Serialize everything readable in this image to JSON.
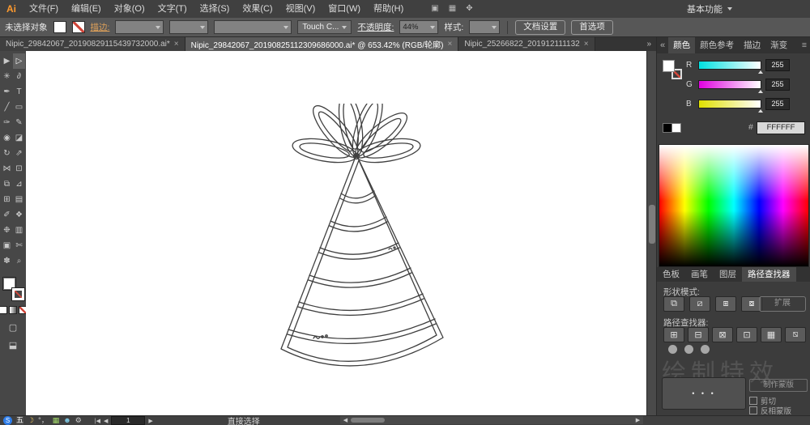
{
  "menubar": {
    "logo": "Ai",
    "items": [
      {
        "id": "file",
        "label": "文件(F)"
      },
      {
        "id": "edit",
        "label": "编辑(E)"
      },
      {
        "id": "object",
        "label": "对象(O)"
      },
      {
        "id": "type",
        "label": "文字(T)"
      },
      {
        "id": "select",
        "label": "选择(S)"
      },
      {
        "id": "effect",
        "label": "效果(C)"
      },
      {
        "id": "view",
        "label": "视图(V)"
      },
      {
        "id": "window",
        "label": "窗口(W)"
      },
      {
        "id": "help",
        "label": "帮助(H)"
      }
    ],
    "right_icons": [
      {
        "id": "arrange-documents-icon",
        "glyph": "▣"
      },
      {
        "id": "workspace-grid-icon",
        "glyph": "▦"
      },
      {
        "id": "cs-services-icon",
        "glyph": "✥"
      }
    ],
    "workspace": "基本功能"
  },
  "controlbar": {
    "selection_status": "未选择对象",
    "stroke_label": "描边:",
    "touch_button": "Touch C...",
    "opacity_label": "不透明度:",
    "opacity_value": "44%",
    "style_label": "样式:",
    "document_setup": "文档设置",
    "preferences": "首选项"
  },
  "document_tabs": {
    "tabs": [
      {
        "title": "Nipic_29842067_20190829115439732000.ai*",
        "active": false
      },
      {
        "title": "Nipic_29842067_20190825112309686000.ai* @ 653.42% (RGB/轮廓)",
        "active": true
      },
      {
        "title": "Nipic_25266822_201912111132",
        "active": false
      }
    ],
    "overflow_icon": "»"
  },
  "toolbar": {
    "tools": [
      {
        "id": "selection-tool",
        "glyph": "▶",
        "active": false
      },
      {
        "id": "direct-selection-tool",
        "glyph": "▷",
        "active": true
      },
      {
        "id": "magic-wand-tool",
        "glyph": "✳",
        "active": false
      },
      {
        "id": "lasso-tool",
        "glyph": "∂",
        "active": false
      },
      {
        "id": "pen-tool",
        "glyph": "✒",
        "active": false
      },
      {
        "id": "type-tool",
        "glyph": "T",
        "active": false
      },
      {
        "id": "line-segment-tool",
        "glyph": "╱",
        "active": false
      },
      {
        "id": "rectangle-tool",
        "glyph": "▭",
        "active": false
      },
      {
        "id": "paintbrush-tool",
        "glyph": "✑",
        "active": false
      },
      {
        "id": "pencil-tool",
        "glyph": "✎",
        "active": false
      },
      {
        "id": "blob-brush-tool",
        "glyph": "◉",
        "active": false
      },
      {
        "id": "eraser-tool",
        "glyph": "◪",
        "active": false
      },
      {
        "id": "rotate-tool",
        "glyph": "↻",
        "active": false
      },
      {
        "id": "scale-tool",
        "glyph": "⇗",
        "active": false
      },
      {
        "id": "width-tool",
        "glyph": "⋈",
        "active": false
      },
      {
        "id": "free-transform-tool",
        "glyph": "⊡",
        "active": false
      },
      {
        "id": "shape-builder-tool",
        "glyph": "⧉",
        "active": false
      },
      {
        "id": "perspective-grid-tool",
        "glyph": "⊿",
        "active": false
      },
      {
        "id": "mesh-tool",
        "glyph": "⊞",
        "active": false
      },
      {
        "id": "gradient-tool",
        "glyph": "▤",
        "active": false
      },
      {
        "id": "eyedropper-tool",
        "glyph": "✐",
        "active": false
      },
      {
        "id": "blend-tool",
        "glyph": "❖",
        "active": false
      },
      {
        "id": "symbol-sprayer-tool",
        "glyph": "❉",
        "active": false
      },
      {
        "id": "column-graph-tool",
        "glyph": "▥",
        "active": false
      },
      {
        "id": "artboard-tool",
        "glyph": "▣",
        "active": false
      },
      {
        "id": "slice-tool",
        "glyph": "✄",
        "active": false
      },
      {
        "id": "hand-tool",
        "glyph": "✽",
        "active": false
      },
      {
        "id": "zoom-tool",
        "glyph": "⌕",
        "active": false
      }
    ],
    "bottom_icons": [
      {
        "id": "draw-mode-button",
        "glyph": "▢"
      },
      {
        "id": "screen-mode-button",
        "glyph": "⬓"
      }
    ]
  },
  "dock": {
    "collapse_icon": "«",
    "menu_icon": "≡",
    "tabs": [
      {
        "id": "color",
        "label": "颜色",
        "active": true
      },
      {
        "id": "color-guide",
        "label": "颜色参考",
        "active": false
      },
      {
        "id": "stroke",
        "label": "描边",
        "active": false
      },
      {
        "id": "gradient",
        "label": "渐变",
        "active": false
      }
    ],
    "color_panel": {
      "channels": [
        {
          "label": "R",
          "value": "255",
          "gradient": [
            "#00E0E0",
            "#FFFFFF"
          ]
        },
        {
          "label": "G",
          "value": "255",
          "gradient": [
            "#E000E0",
            "#FFFFFF"
          ]
        },
        {
          "label": "B",
          "value": "255",
          "gradient": [
            "#E0E000",
            "#FFFFFF"
          ]
        }
      ],
      "hex_label": "#",
      "hex_value": "FFFFFF"
    },
    "panel_tabs": [
      {
        "id": "swatches",
        "label": "色板",
        "active": false
      },
      {
        "id": "brushes",
        "label": "画笔",
        "active": false
      },
      {
        "id": "layers",
        "label": "图层",
        "active": false
      },
      {
        "id": "pathfinder",
        "label": "路径查找器",
        "active": true
      }
    ],
    "pathfinder_panel": {
      "shape_modes_label": "形状模式:",
      "shape_mode_buttons": [
        {
          "id": "unite-icon",
          "glyph": "⧉"
        },
        {
          "id": "minus-front-icon",
          "glyph": "⧄"
        },
        {
          "id": "intersect-icon",
          "glyph": "⧆"
        },
        {
          "id": "exclude-icon",
          "glyph": "⧇"
        }
      ],
      "expand_button": "扩展",
      "pathfinder_label": "路径查找器:",
      "pathfinder_buttons": [
        {
          "id": "divide-icon",
          "glyph": "⊞"
        },
        {
          "id": "trim-icon",
          "glyph": "⊟"
        },
        {
          "id": "merge-icon",
          "glyph": "⊠"
        },
        {
          "id": "crop-icon",
          "glyph": "⊡"
        },
        {
          "id": "outline-icon",
          "glyph": "▦"
        },
        {
          "id": "minus-back-icon",
          "glyph": "⧅"
        }
      ]
    },
    "transparency_panel": {
      "thumbnail_dots": "• • •",
      "make_mask": "制作蒙版",
      "clip_label": "剪切",
      "invert_mask_label": "反相蒙版"
    },
    "watermark": {
      "dots": 3,
      "text": "绘制特效"
    }
  },
  "statusbar": {
    "nav": [
      {
        "id": "first-artboard-button",
        "glyph": "|◀",
        "field": false
      },
      {
        "id": "prev-artboard-button",
        "glyph": "◀",
        "field": false
      },
      {
        "id": "artboard-number-field",
        "glyph": "1",
        "field": true
      },
      {
        "id": "next-artboard-button",
        "glyph": "▶",
        "field": false
      }
    ],
    "tool_name": "直接选择",
    "scroll_left_icon": "◀",
    "scroll_right_icon": "▶"
  },
  "taskbar": {
    "icons": [
      {
        "id": "sogou-icon",
        "glyph": "S",
        "bg": "#2e7de9",
        "fg": "#ffffff",
        "round": true
      },
      {
        "id": "wubi-icon",
        "glyph": "五",
        "bg": "#4a4a4a",
        "fg": "#ffffff",
        "round": false
      },
      {
        "id": "moon-icon",
        "glyph": "☽",
        "bg": "",
        "fg": "#e8c15a",
        "round": false
      },
      {
        "id": "punctuation-icon",
        "glyph": "°，",
        "bg": "",
        "fg": "#cccccc",
        "round": false
      },
      {
        "id": "keyboard-icon",
        "glyph": "▦",
        "bg": "",
        "fg": "#9fd468",
        "round": false
      },
      {
        "id": "user-icon",
        "glyph": "☻",
        "bg": "",
        "fg": "#7ec8e3",
        "round": false
      },
      {
        "id": "wrench-icon",
        "glyph": "⚙",
        "bg": "",
        "fg": "#cccccc",
        "round": false
      }
    ]
  }
}
